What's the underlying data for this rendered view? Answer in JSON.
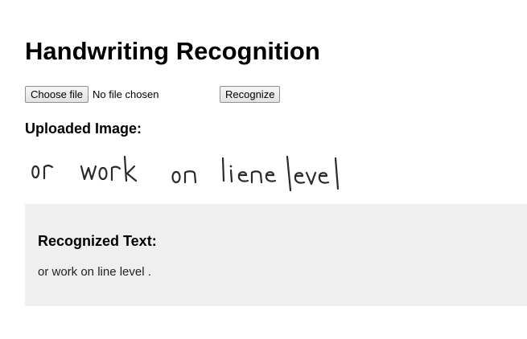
{
  "page": {
    "title": "Handwriting Recognition"
  },
  "upload": {
    "choose_file_label": "Choose file",
    "file_status": "No file chosen",
    "recognize_label": "Recognize"
  },
  "uploaded": {
    "heading": "Uploaded Image:",
    "handwritten_text": "or work on line level"
  },
  "result": {
    "heading": "Recognized Text:",
    "text": "or work on line level ."
  },
  "colors": {
    "result_panel_bg": "#efefef",
    "ink": "#2a2a2a"
  }
}
